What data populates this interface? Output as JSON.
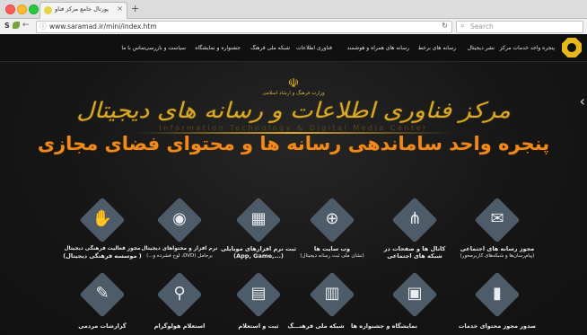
{
  "browser": {
    "tab_title": "پورتال جامع مرکز فناوری اطلا...",
    "new_tab_icon": "plus-icon",
    "url": "www.saramad.ir/mini/index.htm",
    "search_placeholder": "Search"
  },
  "nav": {
    "items": [
      {
        "label": "پنجره واحد خدمات مرکز"
      },
      {
        "label": "نشر دیجیتال"
      },
      {
        "label": "رسانه های برخط"
      },
      {
        "label": "رسانه های همراه و هوشمند"
      },
      {
        "label": "فناوری اطلاعات"
      },
      {
        "label": "شبکه ملی فرهنگ"
      },
      {
        "label": "جشنواره و نمایشگاه"
      },
      {
        "label": "سیاست و بازرسی"
      },
      {
        "label": "تماس با ما"
      }
    ]
  },
  "hero": {
    "emblem_icon": "iran-emblem-icon",
    "ministry": "وزارت فرهنگ و ارشاد اسلامی",
    "center_name_fa": "مرکز فناوری اطلاعات و رسانه های دیجیتال",
    "center_name_en": "Information Technology & Digital Media Center",
    "headline": "پنجره واحد ساماندهی رسانه ها و محتوای فضای مجازی"
  },
  "tiles": {
    "row1": [
      {
        "icon": "envelope-megaphone-icon",
        "label1": "مجوز رسانه های اجتماعی",
        "label2": "(پیام‌رسان‌ها و شبکه‌های کاربرمحور)"
      },
      {
        "icon": "share-nodes-icon",
        "label1": "کانال ها و صفحات در",
        "label2": "شبکه های اجتماعی"
      },
      {
        "icon": "globe-web-icon",
        "label1": "وب سایت ها",
        "label2": "(نشان ملی ثبت رسانه دیجیتال)"
      },
      {
        "icon": "tablet-app-icon",
        "label1": "ثبت نرم افزارهای موبایلی",
        "label2": "(App, Game,...)"
      },
      {
        "icon": "media-disc-icon",
        "label1": "نرم افزار و محتواهای دیجیتال",
        "label2": "برحامل (DVD، لوح فشرده و...)"
      },
      {
        "icon": "handshake-icon",
        "label1": "مجوز فعالیت فرهنگی دیجیتال",
        "label2": "( موسسه فرهنگی دیجیتال)"
      }
    ],
    "row2": [
      {
        "icon": "growth-chart-icon",
        "label1": "صدور مجوز محتوای خدمات",
        "label2": ""
      },
      {
        "icon": "picture-frame-icon",
        "label1": "نمایشگاه و جشنواره ها",
        "label2": ""
      },
      {
        "icon": "building-network-icon",
        "label1": "شبکه ملی فرهنـــگ",
        "label2": ""
      },
      {
        "icon": "certificate-icon",
        "label1": "ثبت و استعلام",
        "label2": ""
      },
      {
        "icon": "hologram-search-icon",
        "label1": "استعلام هولوگرام",
        "label2": ""
      },
      {
        "icon": "report-pen-icon",
        "label1": "گزارشات مردمی",
        "label2": ""
      }
    ]
  },
  "colors": {
    "gold": "#d9a929",
    "orange": "#ee8b1c",
    "tile_bg": "#4e5b68",
    "background": "#161616"
  }
}
